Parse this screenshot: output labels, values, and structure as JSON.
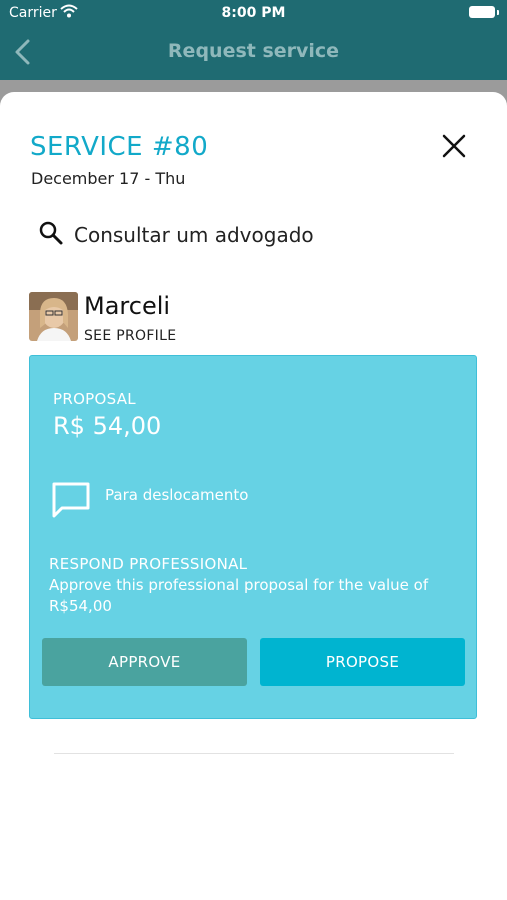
{
  "status_bar": {
    "carrier": "Carrier",
    "time": "8:00 PM"
  },
  "nav": {
    "title": "Request service"
  },
  "service": {
    "title": "SERVICE #80",
    "date": "December 17 - Thu"
  },
  "search": {
    "text": "Consultar um advogado"
  },
  "professional": {
    "name": "Marceli",
    "see_profile": "SEE PROFILE"
  },
  "proposal": {
    "label": "PROPOSAL",
    "value": "R$ 54,00",
    "note": "Para deslocamento",
    "respond_title": "RESPOND PROFESSIONAL",
    "respond_text": "Approve this professional proposal for the value of R$54,00",
    "approve_label": "APPROVE",
    "propose_label": "PROPOSE"
  },
  "colors": {
    "nav_bar": "#1f6b72",
    "accent": "#12a9c9",
    "card": "#66d2e4",
    "approve": "#4aa39f",
    "propose": "#00b4d0"
  }
}
